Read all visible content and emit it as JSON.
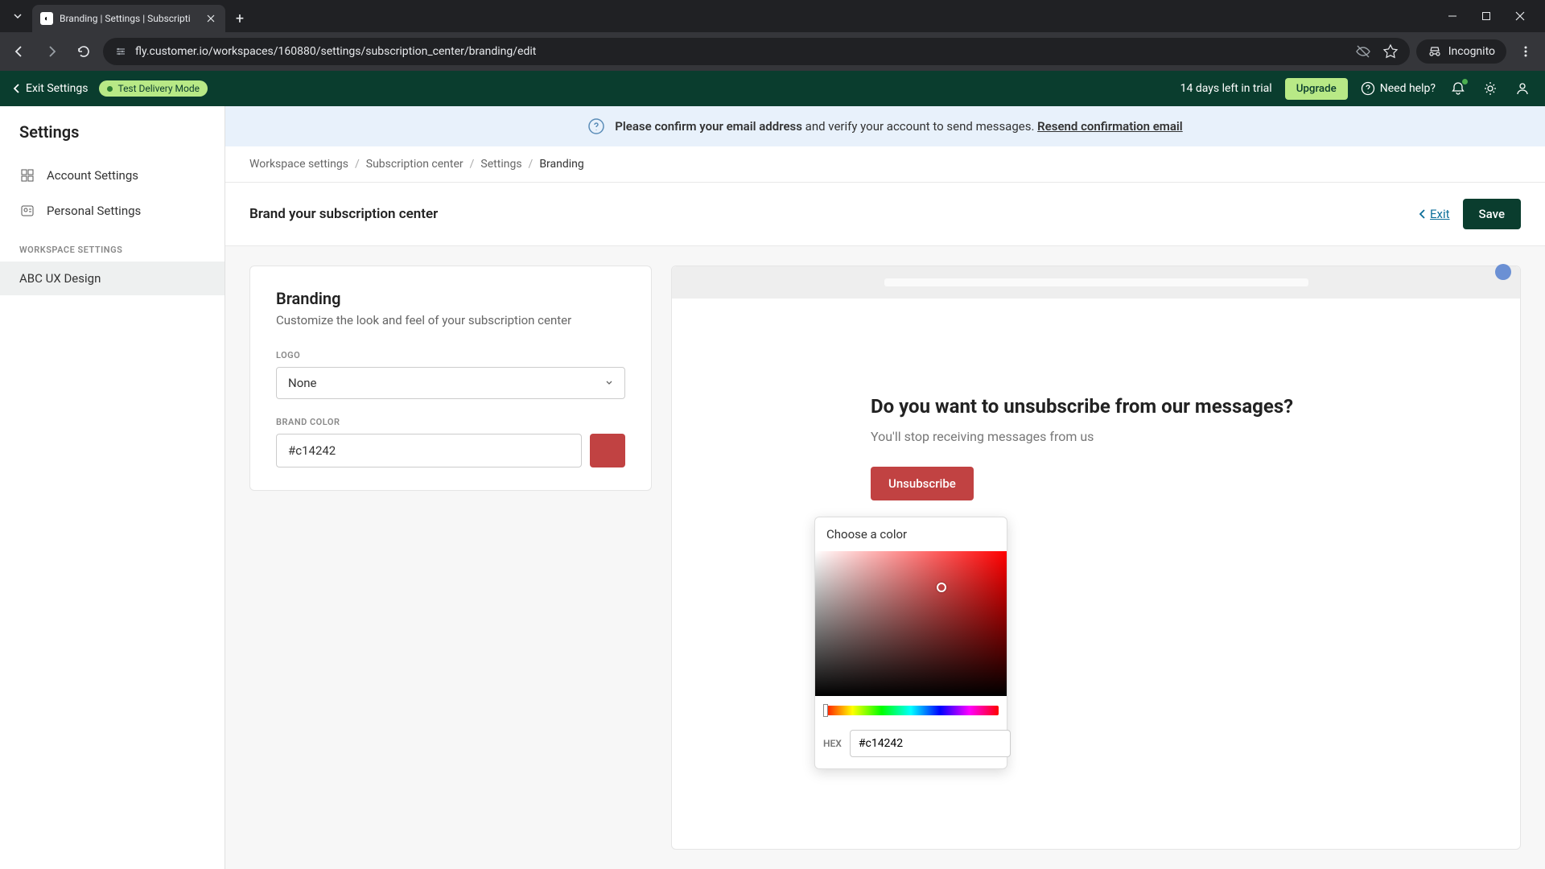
{
  "browser": {
    "tab_title": "Branding | Settings | Subscripti",
    "url": "fly.customer.io/workspaces/160880/settings/subscription_center/branding/edit",
    "incognito_label": "Incognito"
  },
  "header": {
    "exit_settings": "Exit Settings",
    "delivery_mode": "Test Delivery Mode",
    "trial": "14 days left in trial",
    "upgrade": "Upgrade",
    "need_help": "Need help?"
  },
  "sidebar": {
    "title": "Settings",
    "items": [
      {
        "label": "Account Settings"
      },
      {
        "label": "Personal Settings"
      }
    ],
    "section_label": "WORKSPACE SETTINGS",
    "workspace": "ABC UX Design"
  },
  "banner": {
    "strong": "Please confirm your email address",
    "rest": " and verify your account to send messages. ",
    "link": "Resend confirmation email"
  },
  "breadcrumbs": [
    "Workspace settings",
    "Subscription center",
    "Settings",
    "Branding"
  ],
  "page": {
    "title": "Brand your subscription center",
    "exit": "Exit",
    "save": "Save"
  },
  "branding_panel": {
    "title": "Branding",
    "subtitle": "Customize the look and feel of your subscription center",
    "logo_label": "LOGO",
    "logo_value": "None",
    "color_label": "BRAND COLOR",
    "color_value": "#c14242"
  },
  "color_picker": {
    "title": "Choose a color",
    "hex_label": "HEX",
    "hex_value": "#c14242"
  },
  "preview": {
    "title": "Do you want to unsubscribe from our messages?",
    "subtitle": "You'll stop receiving messages from us",
    "button": "Unsubscribe"
  },
  "colors": {
    "brand": "#c14242",
    "app_header": "#0a3d2e",
    "accent_green": "#b8e986"
  }
}
